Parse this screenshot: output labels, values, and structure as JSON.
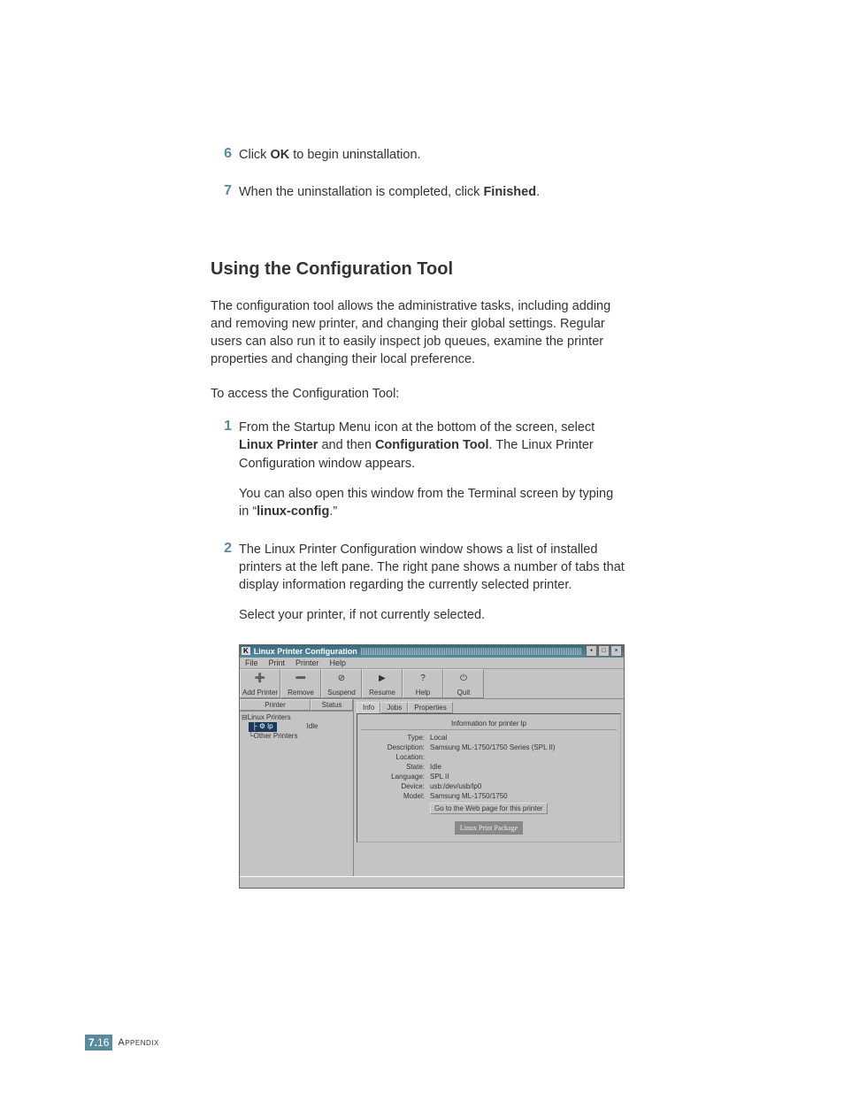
{
  "steps_top": [
    {
      "num": "6",
      "html": "Click <b>OK</b> to begin uninstallation."
    },
    {
      "num": "7",
      "html": "When the uninstallation is completed, click <b>Finished</b>."
    }
  ],
  "heading": "Using the Configuration Tool",
  "intro_para": "The configuration tool allows the administrative tasks, including adding and removing new printer, and changing their global settings. Regular users can also run it to easily inspect job queues, examine the printer properties and changing their local preference.",
  "access_para": "To access the Configuration Tool:",
  "step1": {
    "num": "1",
    "main_html": "From the Startup Menu icon at the bottom of the screen, select <b>Linux Printer</b> and then <b>Configuration Tool</b>. The Linux Printer Configuration window appears.",
    "sub_html": "You can also open this window from the Terminal screen by typing in “<b>linux-config</b>.”"
  },
  "step2": {
    "num": "2",
    "main_html": "The Linux Printer Configuration window shows a list of installed printers at the left pane. The right pane shows a number of tabs that display information regarding the currently selected printer.",
    "sub_html": "Select your printer, if not currently selected."
  },
  "win": {
    "title": "Linux Printer Configuration",
    "menus": [
      "File",
      "Print",
      "Printer",
      "Help"
    ],
    "toolbar": [
      {
        "name": "add-printer-button",
        "label": "Add Printer",
        "icon": "➕"
      },
      {
        "name": "remove-button",
        "label": "Remove",
        "icon": "➖"
      },
      {
        "name": "suspend-button",
        "label": "Suspend",
        "icon": "⊘"
      },
      {
        "name": "resume-button",
        "label": "Resume",
        "icon": "▶"
      },
      {
        "name": "help-button",
        "label": "Help",
        "icon": "?"
      },
      {
        "name": "quit-button",
        "label": "Quit",
        "icon": "⏻"
      }
    ],
    "left": {
      "headers": [
        "Printer",
        "Status"
      ],
      "root": "Linux Printers",
      "selected": {
        "name": "lp",
        "status": "Idle"
      },
      "other": "Other Printers"
    },
    "tabs": [
      "Info",
      "Jobs",
      "Properties"
    ],
    "info": {
      "title": "Information for printer lp",
      "rows": [
        {
          "lbl": "Type:",
          "val": "Local"
        },
        {
          "lbl": "Description:",
          "val": "Samsung ML-1750/1750 Series (SPL II)"
        },
        {
          "lbl": "Location:",
          "val": ""
        },
        {
          "lbl": "State:",
          "val": "Idle"
        },
        {
          "lbl": "Language:",
          "val": "SPL II"
        },
        {
          "lbl": "Device:",
          "val": "usb:/dev/usb/lp0"
        },
        {
          "lbl": "Model:",
          "val": "Samsung ML-1750/1750"
        }
      ],
      "go_button": "Go to the Web page for this printer",
      "logo": "Linux Print Package"
    }
  },
  "footer": {
    "chapter": "7.",
    "page": "16",
    "label": "Appendix"
  }
}
